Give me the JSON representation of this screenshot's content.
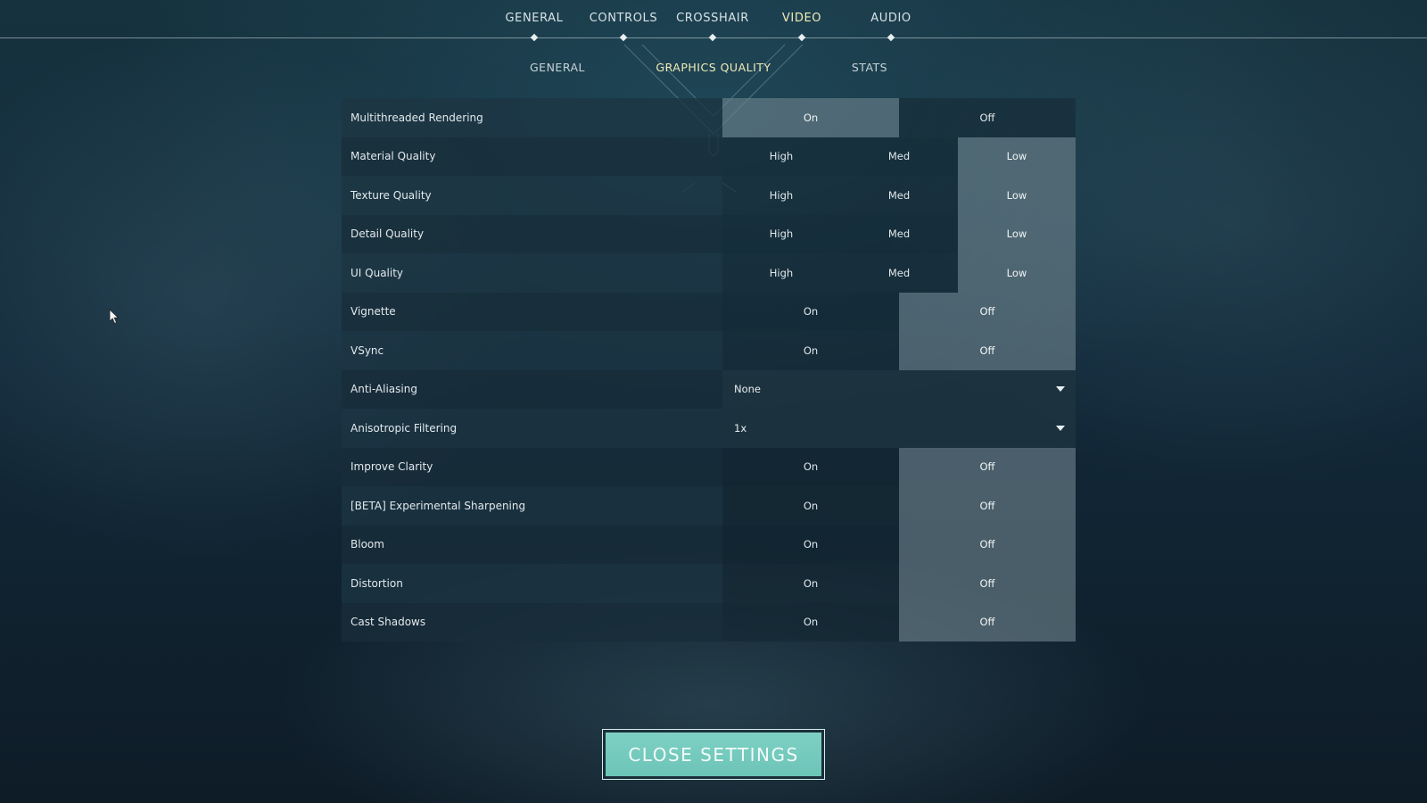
{
  "nav": {
    "tabs": [
      {
        "label": "GENERAL"
      },
      {
        "label": "CONTROLS"
      },
      {
        "label": "CROSSHAIR"
      },
      {
        "label": "VIDEO"
      },
      {
        "label": "AUDIO"
      }
    ],
    "active_tab": "VIDEO",
    "subtabs": [
      {
        "label": "GENERAL"
      },
      {
        "label": "GRAPHICS QUALITY"
      },
      {
        "label": "STATS"
      }
    ],
    "active_subtab": "GRAPHICS QUALITY"
  },
  "settings": [
    {
      "label": "Multithreaded Rendering",
      "options": [
        "On",
        "Off"
      ],
      "selected": "On"
    },
    {
      "label": "Material Quality",
      "options": [
        "High",
        "Med",
        "Low"
      ],
      "selected": "Low"
    },
    {
      "label": "Texture Quality",
      "options": [
        "High",
        "Med",
        "Low"
      ],
      "selected": "Low"
    },
    {
      "label": "Detail Quality",
      "options": [
        "High",
        "Med",
        "Low"
      ],
      "selected": "Low"
    },
    {
      "label": "UI Quality",
      "options": [
        "High",
        "Med",
        "Low"
      ],
      "selected": "Low"
    },
    {
      "label": "Vignette",
      "options": [
        "On",
        "Off"
      ],
      "selected": "Off"
    },
    {
      "label": "VSync",
      "options": [
        "On",
        "Off"
      ],
      "selected": "Off"
    },
    {
      "label": "Anti-Aliasing",
      "dropdown_value": "None"
    },
    {
      "label": "Anisotropic Filtering",
      "dropdown_value": "1x"
    },
    {
      "label": "Improve Clarity",
      "options": [
        "On",
        "Off"
      ],
      "selected": "Off"
    },
    {
      "label": "[BETA] Experimental Sharpening",
      "options": [
        "On",
        "Off"
      ],
      "selected": "Off"
    },
    {
      "label": "Bloom",
      "options": [
        "On",
        "Off"
      ],
      "selected": "Off"
    },
    {
      "label": "Distortion",
      "options": [
        "On",
        "Off"
      ],
      "selected": "Off"
    },
    {
      "label": "Cast Shadows",
      "options": [
        "On",
        "Off"
      ],
      "selected": "Off"
    }
  ],
  "close_button": {
    "label": "CLOSE SETTINGS"
  },
  "colors": {
    "accent_active_tab": "#f2ebb8",
    "close_button": "#7ed0c4",
    "selected_option": "#6e828c"
  },
  "icons": {
    "dropdown": "chevron-down-icon",
    "cursor": "mouse-pointer-icon",
    "tab_marker": "diamond-icon"
  }
}
